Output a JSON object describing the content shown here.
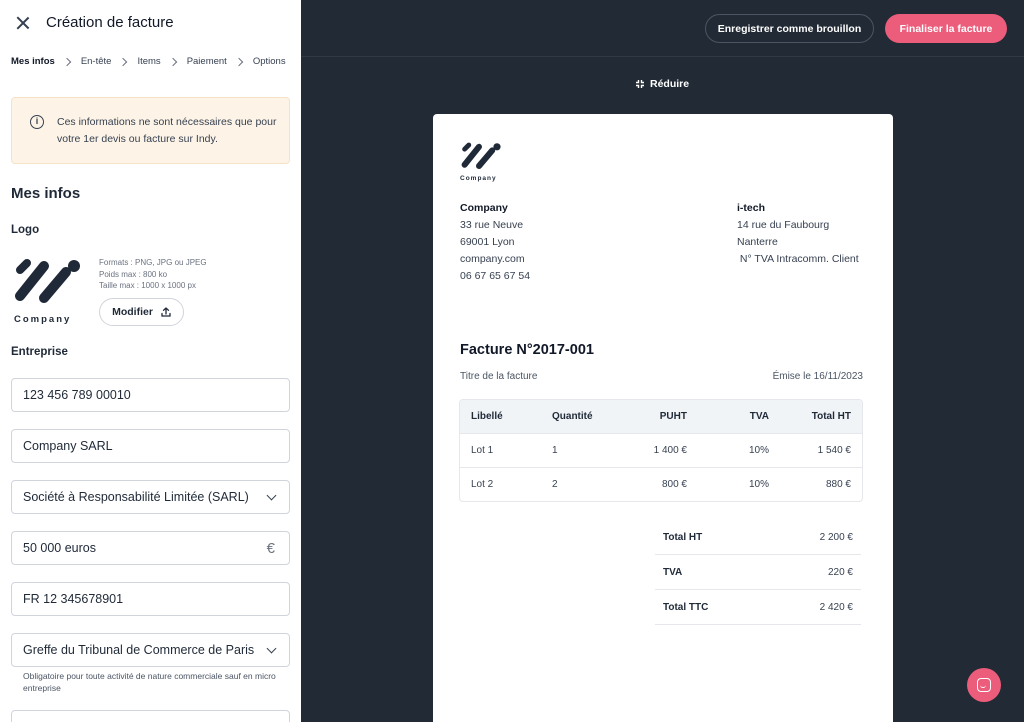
{
  "panel": {
    "title": "Création de facture",
    "breadcrumb": [
      "Mes infos",
      "En-tête",
      "Items",
      "Paiement",
      "Options"
    ],
    "info_text": "Ces informations ne sont nécessaires que pour votre 1er devis ou facture sur Indy.",
    "section_title": "Mes infos",
    "logo_label": "Logo",
    "logo_caption": "Company",
    "logo_formats": [
      "Formats : PNG, JPG ou JPEG",
      "Poids max : 800 ko",
      "Taille max : 1000 x 1000 px"
    ],
    "modify_label": "Modifier",
    "company_label": "Entreprise",
    "fields": {
      "siret": "123 456 789 00010",
      "name": "Company SARL",
      "legal_form": "Société à Responsabilité Limitée (SARL)",
      "capital": "50 000 euros",
      "vat": "FR 12 345678901",
      "registry": "Greffe du Tribunal de Commerce de Paris"
    },
    "registry_help": "Obligatoire pour toute activité de nature commerciale sauf en micro entreprise"
  },
  "toolbar": {
    "draft_label": "Enregistrer comme brouillon",
    "finalize_label": "Finaliser la facture",
    "reduce_label": "Réduire"
  },
  "invoice": {
    "logo_caption": "Company",
    "sender": {
      "name": "Company",
      "street": "33 rue Neuve",
      "city": "69001 Lyon",
      "web": "company.com",
      "phone": "06 67 65 67 54"
    },
    "client": {
      "name": "i-tech",
      "street": "14 rue du Faubourg",
      "city": "Nanterre",
      "vat": " N° TVA Intracomm. Client"
    },
    "title": "Facture N°2017-001",
    "subtitle": "Titre de la facture",
    "issued": "Émise le 16/11/2023",
    "columns": [
      "Libellé",
      "Quantité",
      "PUHT",
      "TVA",
      "Total HT"
    ],
    "rows": [
      [
        "Lot 1",
        "1",
        "1 400 €",
        "10%",
        "1 540 €"
      ],
      [
        "Lot 2",
        "2",
        "800 €",
        "10%",
        "880 €"
      ]
    ],
    "totals": [
      {
        "label": "Total HT",
        "value": "2 200 €"
      },
      {
        "label": "TVA",
        "value": "220 €"
      },
      {
        "label": "Total TTC",
        "value": "2 420 €"
      }
    ]
  },
  "colors": {
    "accent": "#eb5d7b",
    "dark_bg": "#222b35",
    "info_bg": "#fdf4e7"
  }
}
